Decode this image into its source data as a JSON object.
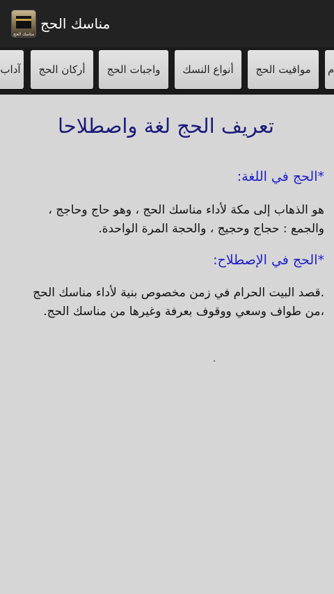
{
  "app": {
    "title": "مناسك الحج",
    "icon_caption": "مناسك الحج"
  },
  "tabs": [
    {
      "label": "آداب"
    },
    {
      "label": "أركان الحج"
    },
    {
      "label": "واجبات الحج"
    },
    {
      "label": "أنواع النسك"
    },
    {
      "label": "مواقيت الحج"
    },
    {
      "label": "م"
    }
  ],
  "content": {
    "heading": "تعريف الحج لغة واصطلاحا",
    "section_language": {
      "title": "*الحج في اللغة:",
      "line1": "هو الذهاب إلى مكة لأداء مناسك الحج ، وهو حاج وحاجج ،",
      "line2": "والجمع : حجاج وحجيج ، والحجة المرة الواحدة."
    },
    "section_term": {
      "title": "*الحج في الإصطلاح:",
      "line1": ".قصد البيت الحرام في زمن مخصوص بنية لأداء مناسك الحج",
      "line2": "،من طواف وسعي ووقوف بعرفة وغيرها من مناسك الحج."
    }
  },
  "colors": {
    "action_bar": "#222222",
    "background": "#d6d6d6",
    "heading": "#1a1a7a",
    "subheading": "#1f1fc8"
  }
}
